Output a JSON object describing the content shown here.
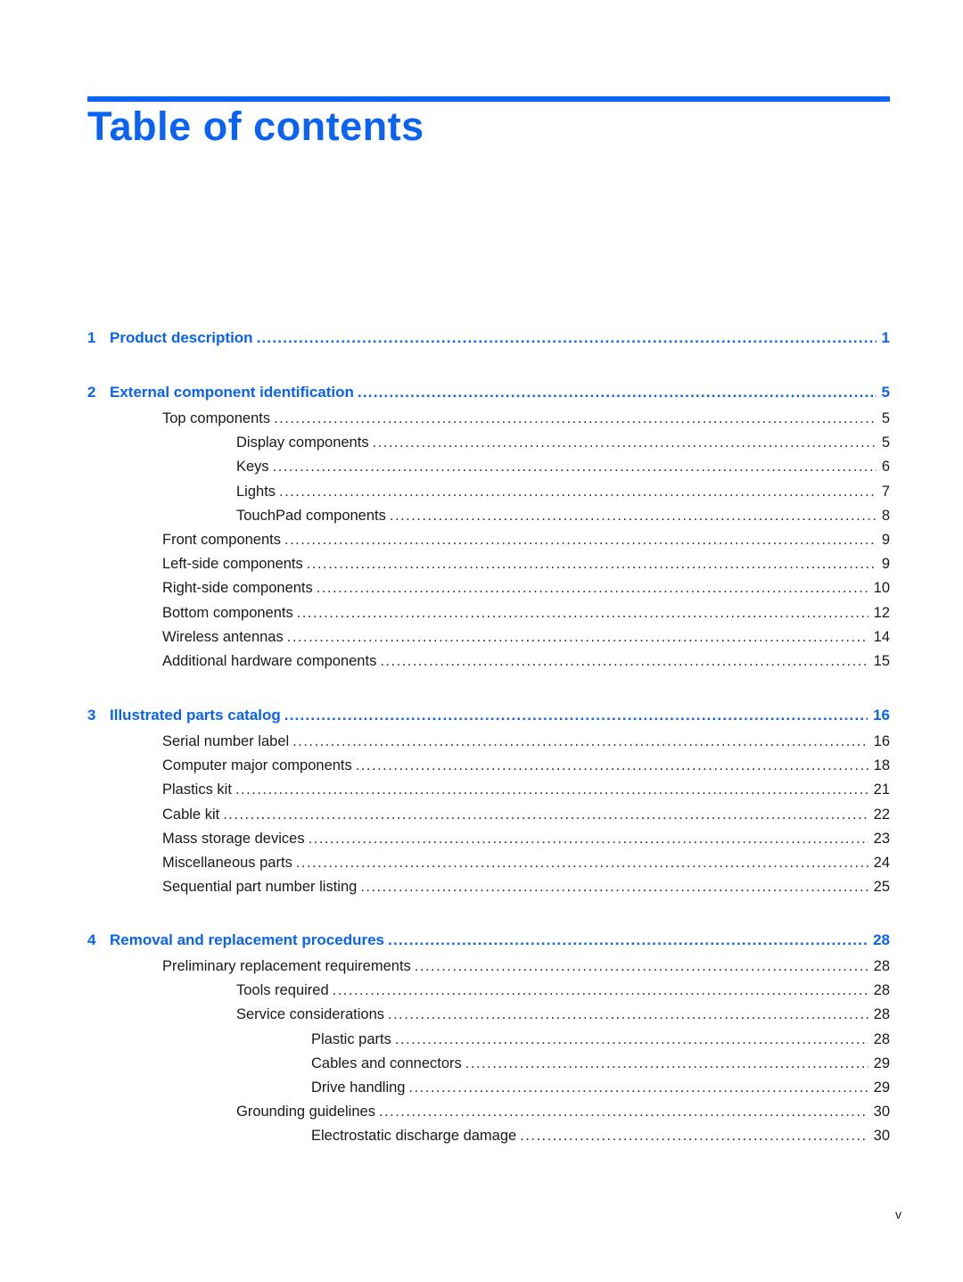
{
  "page": {
    "title": "Table of contents",
    "folio": "v",
    "accent_color": "#0a63f5"
  },
  "toc": {
    "chapters": [
      {
        "number": "1",
        "title": "Product description",
        "page": "1",
        "entries": []
      },
      {
        "number": "2",
        "title": "External component identification",
        "page": "5",
        "entries": [
          {
            "level": 1,
            "title": "Top components",
            "page": "5"
          },
          {
            "level": 2,
            "title": "Display components",
            "page": "5"
          },
          {
            "level": 2,
            "title": "Keys",
            "page": "6"
          },
          {
            "level": 2,
            "title": "Lights",
            "page": "7"
          },
          {
            "level": 2,
            "title": "TouchPad components",
            "page": "8"
          },
          {
            "level": 1,
            "title": "Front components",
            "page": "9"
          },
          {
            "level": 1,
            "title": "Left-side components",
            "page": "9"
          },
          {
            "level": 1,
            "title": "Right-side components",
            "page": "10"
          },
          {
            "level": 1,
            "title": "Bottom components",
            "page": "12"
          },
          {
            "level": 1,
            "title": "Wireless antennas",
            "page": "14"
          },
          {
            "level": 1,
            "title": "Additional hardware components",
            "page": "15"
          }
        ]
      },
      {
        "number": "3",
        "title": "Illustrated parts catalog",
        "page": "16",
        "entries": [
          {
            "level": 1,
            "title": "Serial number label",
            "page": "16"
          },
          {
            "level": 1,
            "title": "Computer major components",
            "page": "18"
          },
          {
            "level": 1,
            "title": "Plastics kit",
            "page": "21"
          },
          {
            "level": 1,
            "title": "Cable kit",
            "page": "22"
          },
          {
            "level": 1,
            "title": "Mass storage devices",
            "page": "23"
          },
          {
            "level": 1,
            "title": "Miscellaneous parts",
            "page": "24"
          },
          {
            "level": 1,
            "title": "Sequential part number listing",
            "page": "25"
          }
        ]
      },
      {
        "number": "4",
        "title": "Removal and replacement procedures",
        "page": "28",
        "entries": [
          {
            "level": 1,
            "title": "Preliminary replacement requirements",
            "page": "28"
          },
          {
            "level": 2,
            "title": "Tools required",
            "page": "28"
          },
          {
            "level": 2,
            "title": "Service considerations",
            "page": "28"
          },
          {
            "level": 3,
            "title": "Plastic parts",
            "page": "28"
          },
          {
            "level": 3,
            "title": "Cables and connectors",
            "page": "29"
          },
          {
            "level": 3,
            "title": "Drive handling",
            "page": "29"
          },
          {
            "level": 2,
            "title": "Grounding guidelines",
            "page": "30"
          },
          {
            "level": 3,
            "title": "Electrostatic discharge damage",
            "page": "30"
          }
        ]
      }
    ]
  }
}
